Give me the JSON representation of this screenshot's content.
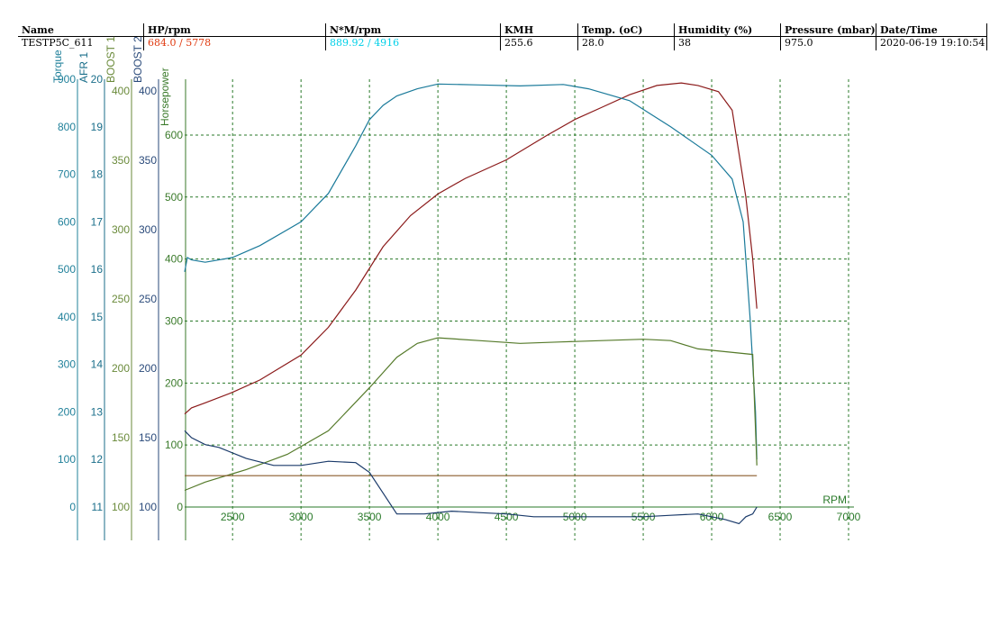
{
  "header": {
    "columns": [
      {
        "title": "Name",
        "value": "TESTP5C_611",
        "color": "#000000"
      },
      {
        "title": "HP/rpm",
        "value": "684.0 / 5778",
        "color": "#e03a10"
      },
      {
        "title": "N*M/rpm",
        "value": "889.92 / 4916",
        "color": "#00d0e8"
      },
      {
        "title": "KMH",
        "value": "255.6",
        "color": "#000000"
      },
      {
        "title": "Temp. (oC)",
        "value": "28.0",
        "color": "#000000"
      },
      {
        "title": "Humidity (%)",
        "value": " 38",
        "color": "#000000"
      },
      {
        "title": "Pressure (mbar)",
        "value": "975.0",
        "color": "#000000"
      },
      {
        "title": "Date/Time",
        "value": "2020-06-19 19:10:54",
        "color": "#000000"
      }
    ]
  },
  "chart_data": {
    "type": "line",
    "x_label": "RPM",
    "x_range": [
      2150,
      7000
    ],
    "x_ticks": [
      2500,
      3000,
      3500,
      4000,
      4500,
      5000,
      5500,
      6000,
      6500,
      7000
    ],
    "grid": true,
    "axes": [
      {
        "name": "Torque",
        "color": "#20809a",
        "ticks": [
          0,
          100,
          200,
          300,
          400,
          500,
          600,
          700,
          800,
          900
        ],
        "range": [
          0,
          900
        ]
      },
      {
        "name": "AFR 1",
        "color": "#1a6e8a",
        "ticks": [
          11,
          12,
          13,
          14,
          15,
          16,
          17,
          18,
          19,
          20
        ],
        "range": [
          11,
          20
        ]
      },
      {
        "name": "BOOST 1",
        "color": "#6a8a3a",
        "ticks": [
          100,
          150,
          200,
          250,
          300,
          350,
          400
        ],
        "range": [
          100,
          400
        ]
      },
      {
        "name": "BOOST 2",
        "color": "#2a4a7a",
        "ticks": [
          100,
          150,
          200,
          250,
          300,
          350,
          400
        ],
        "range": [
          100,
          400
        ]
      },
      {
        "name": "Horsepower",
        "color": "#3a7a2a",
        "ticks": [
          0,
          100,
          200,
          300,
          400,
          500,
          600
        ],
        "range": [
          0,
          690
        ]
      }
    ],
    "series": [
      {
        "name": "Horsepower",
        "color": "#8b1a1a",
        "axis": "Horsepower",
        "x": [
          2150,
          2200,
          2300,
          2500,
          2700,
          3000,
          3200,
          3400,
          3600,
          3800,
          4000,
          4200,
          4500,
          4800,
          5000,
          5200,
          5400,
          5600,
          5778,
          5900,
          6050,
          6150,
          6250,
          6300,
          6330
        ],
        "y": [
          150,
          160,
          168,
          185,
          205,
          245,
          290,
          350,
          420,
          470,
          505,
          530,
          560,
          600,
          625,
          645,
          665,
          680,
          684,
          680,
          670,
          640,
          500,
          400,
          320
        ]
      },
      {
        "name": "Torque",
        "color": "#1a7a9a",
        "axis": "Torque",
        "x": [
          2150,
          2170,
          2200,
          2300,
          2500,
          2700,
          3000,
          3200,
          3400,
          3500,
          3600,
          3700,
          3850,
          4000,
          4300,
          4600,
          4916,
          5100,
          5400,
          5700,
          6000,
          6150,
          6230,
          6280,
          6320,
          6330
        ],
        "y": [
          495,
          525,
          520,
          515,
          525,
          550,
          600,
          660,
          760,
          815,
          845,
          865,
          880,
          890,
          888,
          886,
          889,
          880,
          855,
          800,
          740,
          690,
          600,
          400,
          200,
          100
        ]
      },
      {
        "name": "BOOST 1",
        "color": "#557a2a",
        "axis": "BOOST 1",
        "x": [
          2150,
          2300,
          2600,
          2900,
          3200,
          3500,
          3700,
          3850,
          4000,
          4300,
          4600,
          4900,
          5200,
          5500,
          5700,
          5900,
          6100,
          6300,
          6330
        ],
        "y": [
          112,
          118,
          127,
          138,
          155,
          186,
          208,
          218,
          222,
          220,
          218,
          219,
          220,
          221,
          220,
          214,
          212,
          210,
          130
        ]
      },
      {
        "name": "AFR 1",
        "color": "#8a5a2a",
        "axis": "AFR 1",
        "x": [
          2150,
          6330
        ],
        "y": [
          11.66,
          11.66
        ]
      },
      {
        "name": "BOOST 2",
        "color": "#1a3a6a",
        "axis": "BOOST 2",
        "x": [
          2150,
          2200,
          2300,
          2400,
          2600,
          2800,
          3000,
          3200,
          3400,
          3500,
          3600,
          3700,
          3800,
          3900,
          4100,
          4300,
          4500,
          4700,
          5000,
          5300,
          5500,
          5700,
          5900,
          6000,
          6100,
          6200,
          6250,
          6300,
          6330
        ],
        "y": [
          155,
          150,
          145,
          143,
          135,
          130,
          130,
          133,
          132,
          125,
          110,
          95,
          95,
          95,
          97,
          96,
          95,
          93,
          93,
          93,
          93,
          94,
          95,
          93,
          91,
          88,
          93,
          95,
          100
        ]
      }
    ]
  }
}
